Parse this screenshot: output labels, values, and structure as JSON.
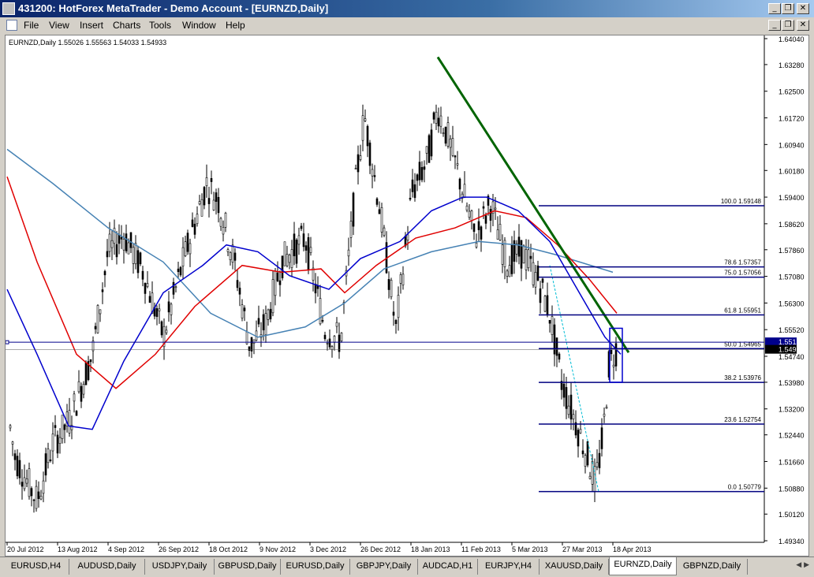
{
  "window": {
    "title": "431200: HotForex MetaTrader - Demo Account - [EURNZD,Daily]",
    "min_glyph": "_",
    "restore_glyph": "❐",
    "close_glyph": "✕"
  },
  "menu": [
    "File",
    "View",
    "Insert",
    "Charts",
    "Tools",
    "Window",
    "Help"
  ],
  "chart_info": "EURNZD,Daily  1.55026 1.55563 1.54033 1.54933",
  "tabs": [
    "EURUSD,H4",
    "AUDUSD,Daily",
    "USDJPY,Daily",
    "GBPUSD,Daily",
    "EURUSD,Daily",
    "GBPJPY,Daily",
    "AUDCAD,H1",
    "EURJPY,H4",
    "XAUUSD,Daily",
    "EURNZD,Daily",
    "GBPNZD,Daily"
  ],
  "active_tab": "EURNZD,Daily",
  "chart_data": {
    "type": "candlestick",
    "symbol": "EURNZD",
    "timeframe": "Daily",
    "last_ohlc": {
      "open": 1.55026,
      "high": 1.55563,
      "low": 1.54033,
      "close": 1.54933
    },
    "y_ticks": [
      "1.64040",
      "1.63280",
      "1.62500",
      "1.61720",
      "1.60940",
      "1.60180",
      "1.59400",
      "1.58620",
      "1.57860",
      "1.57080",
      "1.56300",
      "1.55520",
      "1.54740",
      "1.53980",
      "1.53200",
      "1.52440",
      "1.51660",
      "1.50880",
      "1.50120",
      "1.49340"
    ],
    "ylim": [
      1.4934,
      1.6404
    ],
    "x_ticks": [
      "20 Jul 2012",
      "13 Aug 2012",
      "4 Sep 2012",
      "26 Sep 2012",
      "18 Oct 2012",
      "9 Nov 2012",
      "3 Dec 2012",
      "26 Dec 2012",
      "18 Jan 2013",
      "11 Feb 2013",
      "5 Mar 2013",
      "27 Mar 2013",
      "18 Apr 2013"
    ],
    "current_price_labels": [
      "1.55152",
      "1.54933"
    ],
    "fibonacci": [
      {
        "level": "100.0",
        "price": "1.59148"
      },
      {
        "level": "78.6",
        "price": "1.57357"
      },
      {
        "level": "75.0",
        "price": "1.57056"
      },
      {
        "level": "61.8",
        "price": "1.55951"
      },
      {
        "level": "50.0",
        "price": "1.54965"
      },
      {
        "level": "38.2",
        "price": "1.53976"
      },
      {
        "level": "23.6",
        "price": "1.52754"
      },
      {
        "level": "0.0",
        "price": "1.50779"
      }
    ],
    "colors": {
      "fib": "#000080",
      "candle_body": "#000000",
      "trendline": "#006400",
      "ma_fast": "#0000cd",
      "ma_mid": "#e00000",
      "ma_slow": "#4682b4",
      "hline": "#00008b"
    }
  }
}
